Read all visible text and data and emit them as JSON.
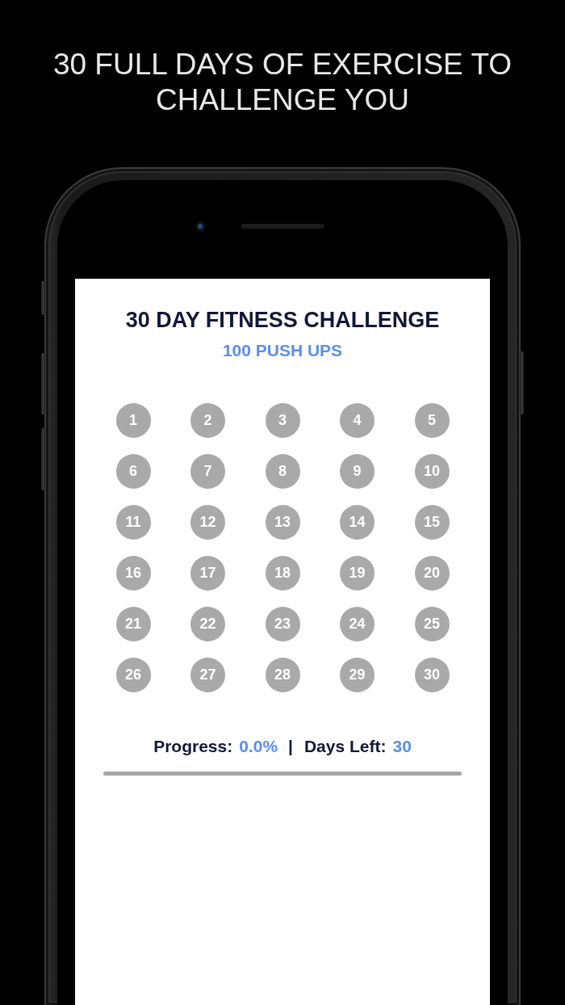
{
  "headline": "30 FULL DAYS OF EXERCISE TO CHALLENGE YOU",
  "screen": {
    "title": "30 DAY FITNESS CHALLENGE",
    "subtitle": "100 PUSH UPS",
    "days": [
      {
        "label": "1",
        "completed": false
      },
      {
        "label": "2",
        "completed": false
      },
      {
        "label": "3",
        "completed": false
      },
      {
        "label": "4",
        "completed": false
      },
      {
        "label": "5",
        "completed": false
      },
      {
        "label": "6",
        "completed": false
      },
      {
        "label": "7",
        "completed": false
      },
      {
        "label": "8",
        "completed": false
      },
      {
        "label": "9",
        "completed": false
      },
      {
        "label": "10",
        "completed": false
      },
      {
        "label": "11",
        "completed": false
      },
      {
        "label": "12",
        "completed": false
      },
      {
        "label": "13",
        "completed": false
      },
      {
        "label": "14",
        "completed": false
      },
      {
        "label": "15",
        "completed": false
      },
      {
        "label": "16",
        "completed": false
      },
      {
        "label": "17",
        "completed": false
      },
      {
        "label": "18",
        "completed": false
      },
      {
        "label": "19",
        "completed": false
      },
      {
        "label": "20",
        "completed": false
      },
      {
        "label": "21",
        "completed": false
      },
      {
        "label": "22",
        "completed": false
      },
      {
        "label": "23",
        "completed": false
      },
      {
        "label": "24",
        "completed": false
      },
      {
        "label": "25",
        "completed": false
      },
      {
        "label": "26",
        "completed": false
      },
      {
        "label": "27",
        "completed": false
      },
      {
        "label": "28",
        "completed": false
      },
      {
        "label": "29",
        "completed": false
      },
      {
        "label": "30",
        "completed": false
      }
    ],
    "stats": [
      {
        "label": "Progress:",
        "value": "0.0%"
      },
      {
        "label": "Days Left:",
        "value": "30"
      }
    ],
    "separator": "|",
    "progress_bar": {
      "level": 0
    }
  }
}
